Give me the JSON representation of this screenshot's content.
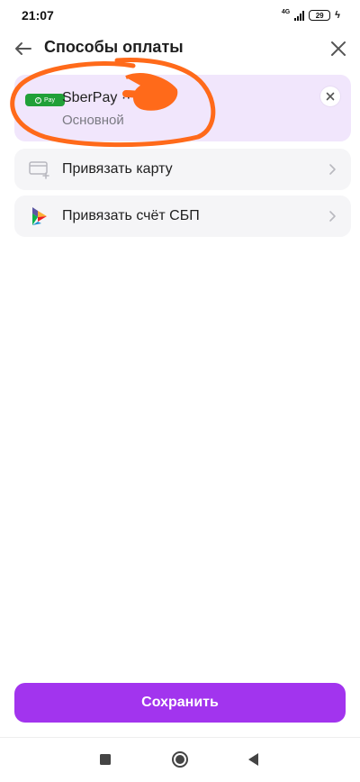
{
  "status_bar": {
    "time": "21:07",
    "network": "4G",
    "battery": "29"
  },
  "header": {
    "title": "Способы оплаты",
    "back_icon": "arrow-left-icon",
    "close_icon": "close-icon"
  },
  "payment_methods": [
    {
      "icon": "sberpay-badge",
      "badge_text": "Pay",
      "name": "SberPay ·· ",
      "subtitle": "Основной",
      "remove_icon": "close-icon"
    }
  ],
  "link_options": [
    {
      "icon": "card-plus-icon",
      "label": "Привязать карту"
    },
    {
      "icon": "sbp-logo-icon",
      "label": "Привязать счёт СБП"
    }
  ],
  "save_button": {
    "label": "Сохранить"
  },
  "colors": {
    "accent": "#a234ee",
    "selected_card_bg": "#f1e6fc",
    "option_bg": "#f5f5f7",
    "sberpay_green": "#21a038",
    "annotation_orange": "#ff6a1a"
  }
}
